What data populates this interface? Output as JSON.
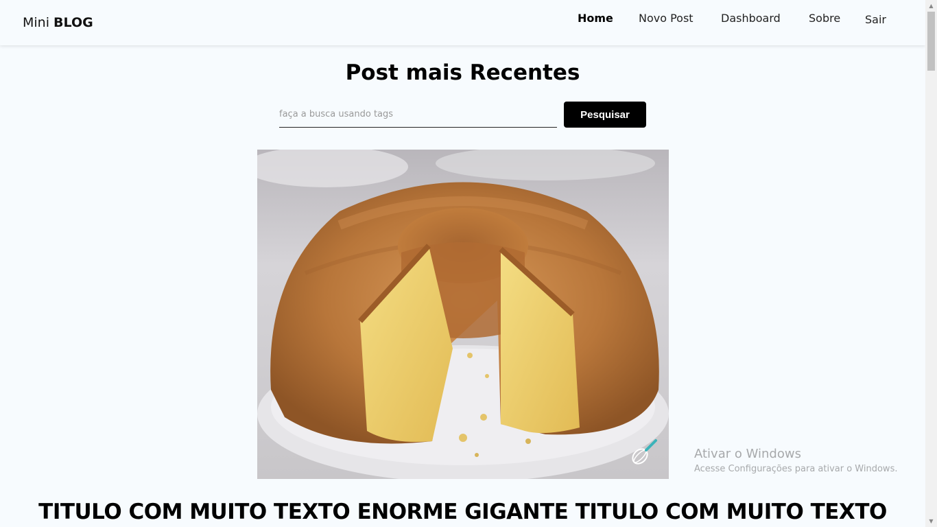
{
  "brand": {
    "prefix": "Mini",
    "bold": "BLOG"
  },
  "nav": {
    "items": [
      {
        "label": "Home",
        "active": true
      },
      {
        "label": "Novo Post",
        "active": false
      },
      {
        "label": "Dashboard",
        "active": false
      },
      {
        "label": "Sobre",
        "active": false
      },
      {
        "label": "Sair",
        "active": false
      }
    ]
  },
  "main": {
    "title": "Post mais Recentes",
    "search": {
      "placeholder": "faça a busca usando tags",
      "value": "",
      "button_label": "Pesquisar"
    },
    "post": {
      "image_subject": "bundt-cake-on-plate",
      "title": "TITULO COM MUITO TEXTO ENORME GIGANTE TITULO COM MUITO TEXTO"
    }
  },
  "watermark": {
    "title": "Ativar o Windows",
    "subtitle": "Acesse Configurações para ativar o Windows."
  },
  "icons": {
    "whisk": "whisk-icon",
    "scroll_up": "scroll-up-arrow-icon",
    "scroll_down": "scroll-down-arrow-icon"
  }
}
